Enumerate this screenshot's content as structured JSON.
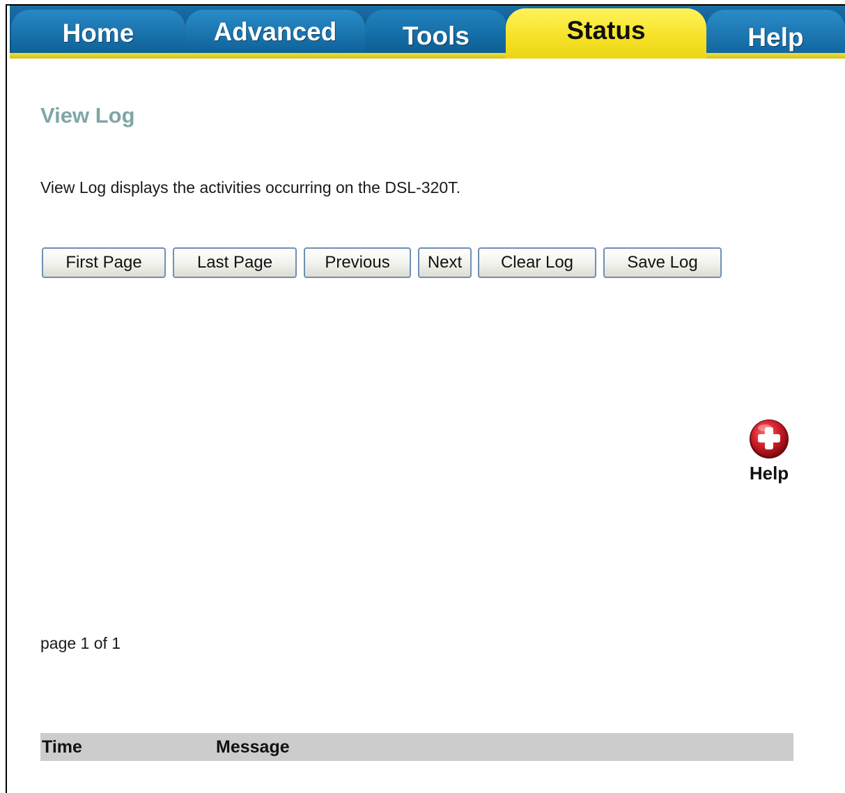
{
  "nav": {
    "tabs": [
      {
        "label": "Home"
      },
      {
        "label": "Advanced"
      },
      {
        "label": "Tools"
      },
      {
        "label": "Status",
        "active": true
      },
      {
        "label": "Help"
      }
    ],
    "bar_color": "#0c5688",
    "active_color": "#f5e025"
  },
  "main": {
    "title": "View Log",
    "description": "View Log displays the activities occurring on the DSL-320T.",
    "buttons": {
      "first_page": "First Page",
      "last_page": "Last Page",
      "previous": "Previous",
      "next": "Next",
      "clear_log": "Clear Log",
      "save_log": "Save Log"
    },
    "page_indicator": "page 1 of 1",
    "table": {
      "columns": [
        "Time",
        "Message"
      ],
      "rows": []
    },
    "title_color": "#7fa6a8"
  },
  "help_widget": {
    "label": "Help",
    "icon": "plus-circle-icon",
    "icon_color": "#d4202a"
  }
}
